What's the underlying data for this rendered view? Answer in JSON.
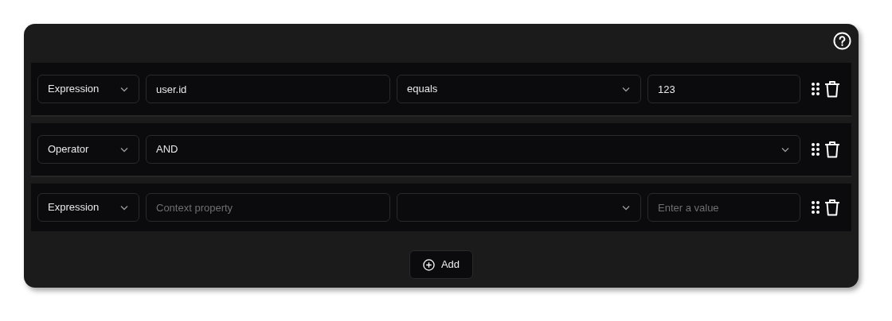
{
  "rows": [
    {
      "kind": "expression",
      "type": "Expression",
      "property": {
        "value": "user.id"
      },
      "operator": "equals",
      "value": {
        "value": "123"
      }
    },
    {
      "kind": "operator",
      "type": "Operator",
      "operator": "AND"
    },
    {
      "kind": "expression",
      "type": "Expression",
      "property": {
        "placeholder": "Context property"
      },
      "value": {
        "placeholder": "Enter a value"
      }
    }
  ],
  "add_button": {
    "label": "Add"
  }
}
